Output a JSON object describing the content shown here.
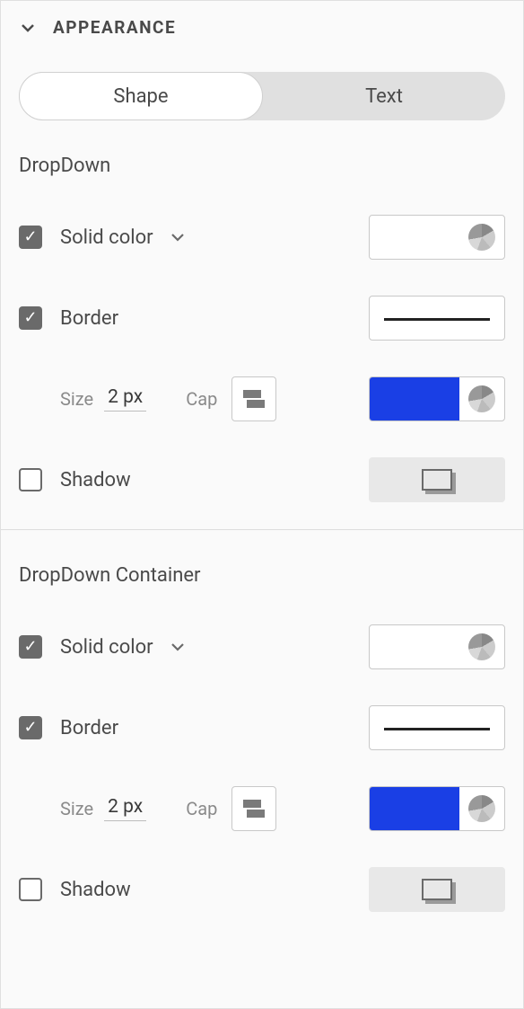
{
  "header": {
    "title": "APPEARANCE"
  },
  "tabs": {
    "shape": "Shape",
    "text": "Text"
  },
  "sections": {
    "dropdown": {
      "title": "DropDown",
      "solid_color_label": "Solid color",
      "border_label": "Border",
      "size_label": "Size",
      "size_value": "2 px",
      "cap_label": "Cap",
      "shadow_label": "Shadow",
      "border_color": "#1a3fe5"
    },
    "container": {
      "title": "DropDown Container",
      "solid_color_label": "Solid color",
      "border_label": "Border",
      "size_label": "Size",
      "size_value": "2 px",
      "cap_label": "Cap",
      "shadow_label": "Shadow",
      "border_color": "#1a3fe5"
    }
  }
}
